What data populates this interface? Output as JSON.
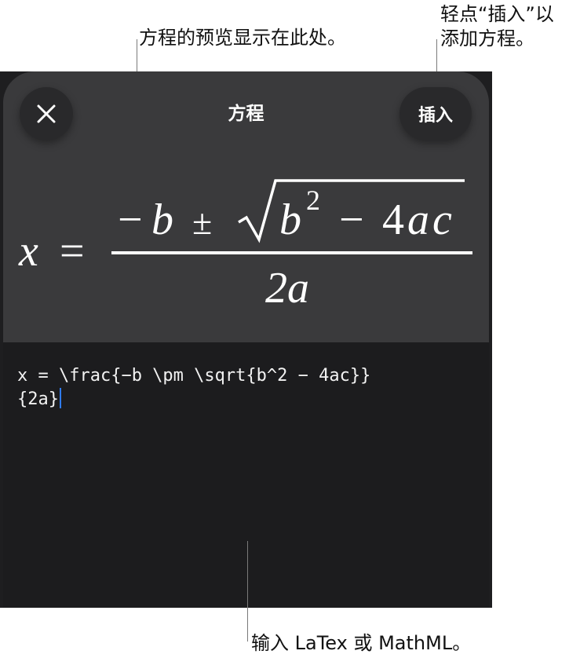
{
  "callouts": {
    "preview": "方程的预览显示在此处。",
    "insert_line1": "轻点“插入”以",
    "insert_line2": "添加方程。",
    "input": "输入 LaTex 或 MathML。"
  },
  "sheet": {
    "title": "方程",
    "insert_label": "插入",
    "close_icon": "close-icon"
  },
  "preview": {
    "lhs": "x",
    "equals": "=",
    "numerator_minus": "−",
    "numerator_b": "b",
    "pm": "±",
    "radicand_b": "b",
    "exponent": "2",
    "radicand_rest_minus": "−",
    "radicand_4": "4",
    "radicand_ac": "ac",
    "denominator": "2a"
  },
  "editor": {
    "line1": "x = \\frac{−b \\pm \\sqrt{b^2 − 4ac}}",
    "line2": "{2a}"
  }
}
